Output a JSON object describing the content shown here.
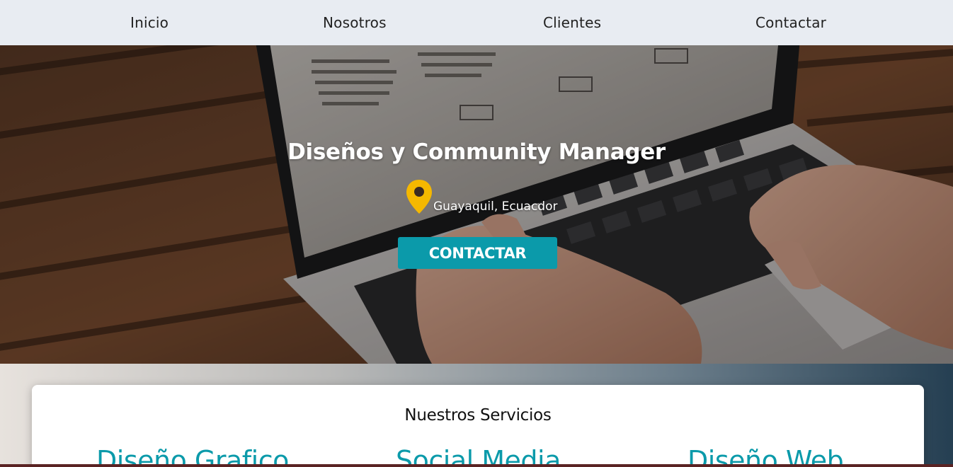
{
  "nav": {
    "items": [
      {
        "label": "Inicio"
      },
      {
        "label": "Nosotros"
      },
      {
        "label": "Clientes"
      },
      {
        "label": "Contactar"
      }
    ]
  },
  "hero": {
    "title": "Diseños y Community Manager",
    "location": "Guayaquil, Ecuacdor",
    "cta_label": "CONTACTAR",
    "location_icon": "map-pin-icon"
  },
  "services": {
    "title": "Nuestros Servicios",
    "items": [
      {
        "label": "Diseño Grafico"
      },
      {
        "label": "Social Media"
      },
      {
        "label": "Diseño Web"
      }
    ]
  },
  "colors": {
    "nav_bg": "#e8ecf2",
    "accent": "#0b9aaa",
    "pin": "#f5b800"
  }
}
